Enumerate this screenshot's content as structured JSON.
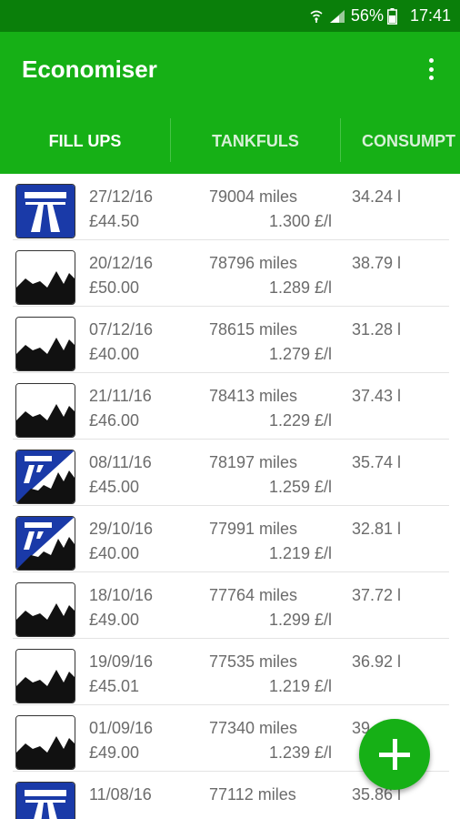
{
  "status_bar": {
    "battery_percent": "56%",
    "time": "17:41"
  },
  "app_bar": {
    "title": "Economiser",
    "menu_icon": "overflow-menu-icon"
  },
  "tabs": [
    {
      "label": "FILL UPS",
      "selected": true
    },
    {
      "label": "TANKFULS",
      "selected": false
    },
    {
      "label": "CONSUMPT",
      "selected": false
    }
  ],
  "fillups": [
    {
      "date": "27/12/16",
      "cost": "£44.50",
      "odometer": "79004 miles",
      "price": "1.300 £/l",
      "volume": "34.24 l",
      "road": "motorway"
    },
    {
      "date": "20/12/16",
      "cost": "£50.00",
      "odometer": "78796 miles",
      "price": "1.289 £/l",
      "volume": "38.79 l",
      "road": "town"
    },
    {
      "date": "07/12/16",
      "cost": "£40.00",
      "odometer": "78615 miles",
      "price": "1.279 £/l",
      "volume": "31.28 l",
      "road": "town"
    },
    {
      "date": "21/11/16",
      "cost": "£46.00",
      "odometer": "78413 miles",
      "price": "1.229 £/l",
      "volume": "37.43 l",
      "road": "town"
    },
    {
      "date": "08/11/16",
      "cost": "£45.00",
      "odometer": "78197 miles",
      "price": "1.259 £/l",
      "volume": "35.74 l",
      "road": "mixed"
    },
    {
      "date": "29/10/16",
      "cost": "£40.00",
      "odometer": "77991 miles",
      "price": "1.219 £/l",
      "volume": "32.81 l",
      "road": "mixed"
    },
    {
      "date": "18/10/16",
      "cost": "£49.00",
      "odometer": "77764 miles",
      "price": "1.299 £/l",
      "volume": "37.72 l",
      "road": "town"
    },
    {
      "date": "19/09/16",
      "cost": "£45.01",
      "odometer": "77535 miles",
      "price": "1.219 £/l",
      "volume": "36.92 l",
      "road": "town"
    },
    {
      "date": "01/09/16",
      "cost": "£49.00",
      "odometer": "77340 miles",
      "price": "1.239 £/l",
      "volume": "39",
      "road": "town"
    },
    {
      "date": "11/08/16",
      "cost": "",
      "odometer": "77112 miles",
      "price": "",
      "volume": "35.86 l",
      "road": "motorway"
    }
  ],
  "fab": {
    "icon": "add-icon"
  },
  "colors": {
    "status_bar": "#0a7f0a",
    "primary": "#16b016",
    "motorway_blue": "#1a3aa8",
    "text_secondary": "#6b6b6b"
  }
}
